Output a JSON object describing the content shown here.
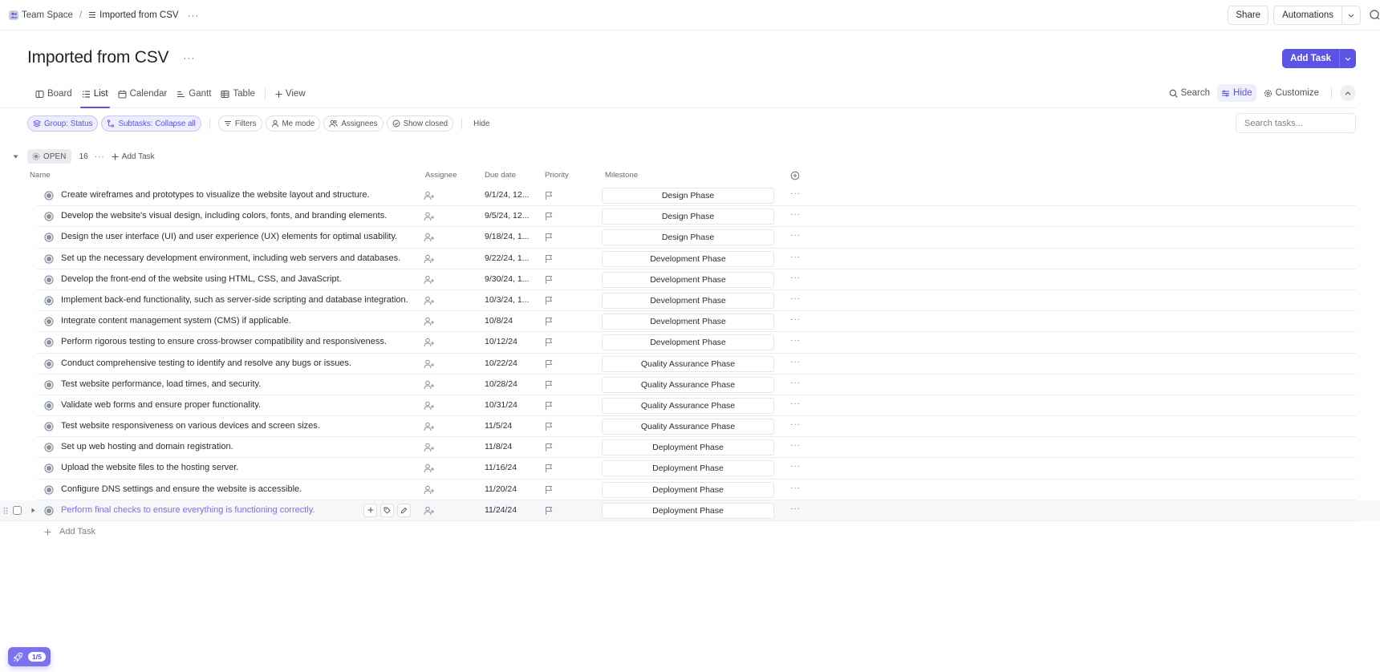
{
  "breadcrumb": {
    "space": "Team Space",
    "separator": "/",
    "list": "Imported from CSV",
    "more": "···"
  },
  "topbar": {
    "share_label": "Share",
    "automations_label": "Automations"
  },
  "header": {
    "title": "Imported from CSV",
    "more": "···",
    "add_task_label": "Add Task"
  },
  "views": {
    "tabs": [
      {
        "label": "Board",
        "icon": "board-icon",
        "active": false
      },
      {
        "label": "List",
        "icon": "list-icon",
        "active": true
      },
      {
        "label": "Calendar",
        "icon": "calendar-icon",
        "active": false
      },
      {
        "label": "Gantt",
        "icon": "gantt-icon",
        "active": false
      },
      {
        "label": "Table",
        "icon": "table-icon",
        "active": false
      }
    ],
    "add_view_label": "View",
    "tools": {
      "search_label": "Search",
      "hide_label": "Hide",
      "customize_label": "Customize"
    }
  },
  "filters": {
    "group_label": "Group: Status",
    "subtasks_label": "Subtasks: Collapse all",
    "filters_label": "Filters",
    "me_mode_label": "Me mode",
    "assignees_label": "Assignees",
    "show_closed_label": "Show closed",
    "hide_label": "Hide",
    "search_placeholder": "Search tasks..."
  },
  "group": {
    "status": "OPEN",
    "count": "16",
    "more": "···",
    "add_task_label": "Add Task",
    "status_color": "#87909e"
  },
  "columns": {
    "name": "Name",
    "assignee": "Assignee",
    "due_date": "Due date",
    "priority": "Priority",
    "milestone": "Milestone"
  },
  "tasks": [
    {
      "name": "Create wireframes and prototypes to visualize the website layout and structure.",
      "due": "9/1/24, 12...",
      "milestone": "Design Phase"
    },
    {
      "name": "Develop the website's visual design, including colors, fonts, and branding elements.",
      "due": "9/5/24, 12...",
      "milestone": "Design Phase"
    },
    {
      "name": "Design the user interface (UI) and user experience (UX) elements for optimal usability.",
      "due": "9/18/24, 1...",
      "milestone": "Design Phase"
    },
    {
      "name": "Set up the necessary development environment, including web servers and databases.",
      "due": "9/22/24, 1...",
      "milestone": "Development Phase"
    },
    {
      "name": "Develop the front-end of the website using HTML, CSS, and JavaScript.",
      "due": "9/30/24, 1...",
      "milestone": "Development Phase"
    },
    {
      "name": "Implement back-end functionality, such as server-side scripting and database integration.",
      "due": "10/3/24, 1...",
      "milestone": "Development Phase"
    },
    {
      "name": "Integrate content management system (CMS) if applicable.",
      "due": "10/8/24",
      "milestone": "Development Phase"
    },
    {
      "name": "Perform rigorous testing to ensure cross-browser compatibility and responsiveness.",
      "due": "10/12/24",
      "milestone": "Development Phase"
    },
    {
      "name": "Conduct comprehensive testing to identify and resolve any bugs or issues.",
      "due": "10/22/24",
      "milestone": "Quality Assurance Phase"
    },
    {
      "name": "Test website performance, load times, and security.",
      "due": "10/28/24",
      "milestone": "Quality Assurance Phase"
    },
    {
      "name": "Validate web forms and ensure proper functionality.",
      "due": "10/31/24",
      "milestone": "Quality Assurance Phase"
    },
    {
      "name": "Test website responsiveness on various devices and screen sizes.",
      "due": "11/5/24",
      "milestone": "Quality Assurance Phase"
    },
    {
      "name": "Set up web hosting and domain registration.",
      "due": "11/8/24",
      "milestone": "Deployment Phase"
    },
    {
      "name": "Upload the website files to the hosting server.",
      "due": "11/16/24",
      "milestone": "Deployment Phase"
    },
    {
      "name": "Configure DNS settings and ensure the website is accessible.",
      "due": "11/20/24",
      "milestone": "Deployment Phase"
    },
    {
      "name": "Perform final checks to ensure everything is functioning correctly.",
      "due": "11/24/24",
      "milestone": "Deployment Phase",
      "hovered": true
    }
  ],
  "row_more": "···",
  "add_task_row_label": "Add Task",
  "launcher": {
    "badge": "1/5"
  },
  "colors": {
    "accent": "#5b53e8",
    "hover_text": "#7c6ff0"
  }
}
